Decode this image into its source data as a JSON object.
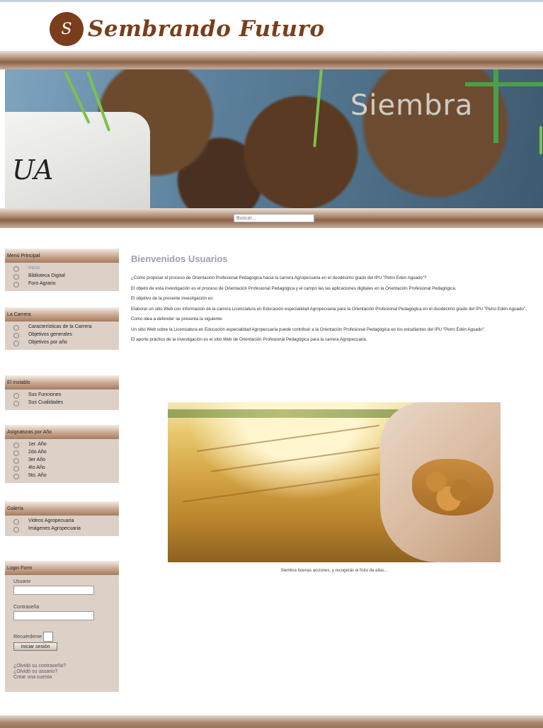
{
  "header": {
    "logo_glyph": "S",
    "site_title": "Sembrando Futuro"
  },
  "banner": {
    "tray_text": "UA",
    "word": "Siembra"
  },
  "search": {
    "placeholder": "Buscar..."
  },
  "modules": [
    {
      "title": "Menú Principal",
      "items": [
        {
          "label": "Inicio",
          "active": true
        },
        {
          "label": "Biblioteca Digital"
        },
        {
          "label": "Foro Agrario"
        }
      ]
    },
    {
      "title": "La Carrera",
      "items": [
        {
          "label": "Características de la Carrera"
        },
        {
          "label": "Objetivos generales"
        },
        {
          "label": "Objetivos por año"
        }
      ]
    },
    {
      "title": "El Instablo",
      "items": [
        {
          "label": "Sus Funciones"
        },
        {
          "label": "Sus Cualidades"
        }
      ]
    },
    {
      "title": "Asignaturas por Año",
      "items": [
        {
          "label": "1er. Año"
        },
        {
          "label": "2do Año"
        },
        {
          "label": "3er Año"
        },
        {
          "label": "4to Año"
        },
        {
          "label": "5to. Año"
        }
      ]
    },
    {
      "title": "Galería",
      "items": [
        {
          "label": "Videos Agropecuaria"
        },
        {
          "label": "Imágenes Agropecuaria"
        }
      ]
    }
  ],
  "login": {
    "title": "Login Form",
    "username_label": "Usuario",
    "password_label": "Contraseña",
    "remember_label": "Recuérdeme",
    "button_label": "Iniciar sesión",
    "links": [
      "¿Olvidó su contraseña?",
      "¿Olvidó su usuario?",
      "Crear una cuenta"
    ]
  },
  "content": {
    "heading": "Bienvenidos Usuarios",
    "paragraphs": [
      "¿Cómo propiciar el proceso de Orientación Profesional Pedagógica hacia la carrera Agropecuaria en el duodécimo grado del IPU \"Petro Edén Aguado\"?",
      "El objeto de esta investigación es el proceso de Orientación Profesional Pedagógica y el campo las las aplicaciones digitales en la Orientación Profesional Pedagógica.",
      "El objetivo de la presente investigación es:",
      "Elaborar un sitio Web con información de la carrera Licenciatura en Educación especialidad Agropecuaria para la Orientación Profesional Pedagógica en el duodécimo grado del IPU \"Petro Edén Aguado\".",
      "Como idea a defender se presenta la siguiente:",
      "Un sitio Web sobre la Licenciatura en Educación especialidad Agropecuaria puede contribuir a la Orientación Profesional Pedagógica en los estudiantes del IPU \"Petro Edén Aguado\".",
      "El aporte práctico de la investigación es el sitio Web de Orientación Profesional Pedagógica para la carrera Agropecuaria."
    ],
    "caption": "Siembra buenas acciones, y recogerás el fruto de ellas..."
  }
}
